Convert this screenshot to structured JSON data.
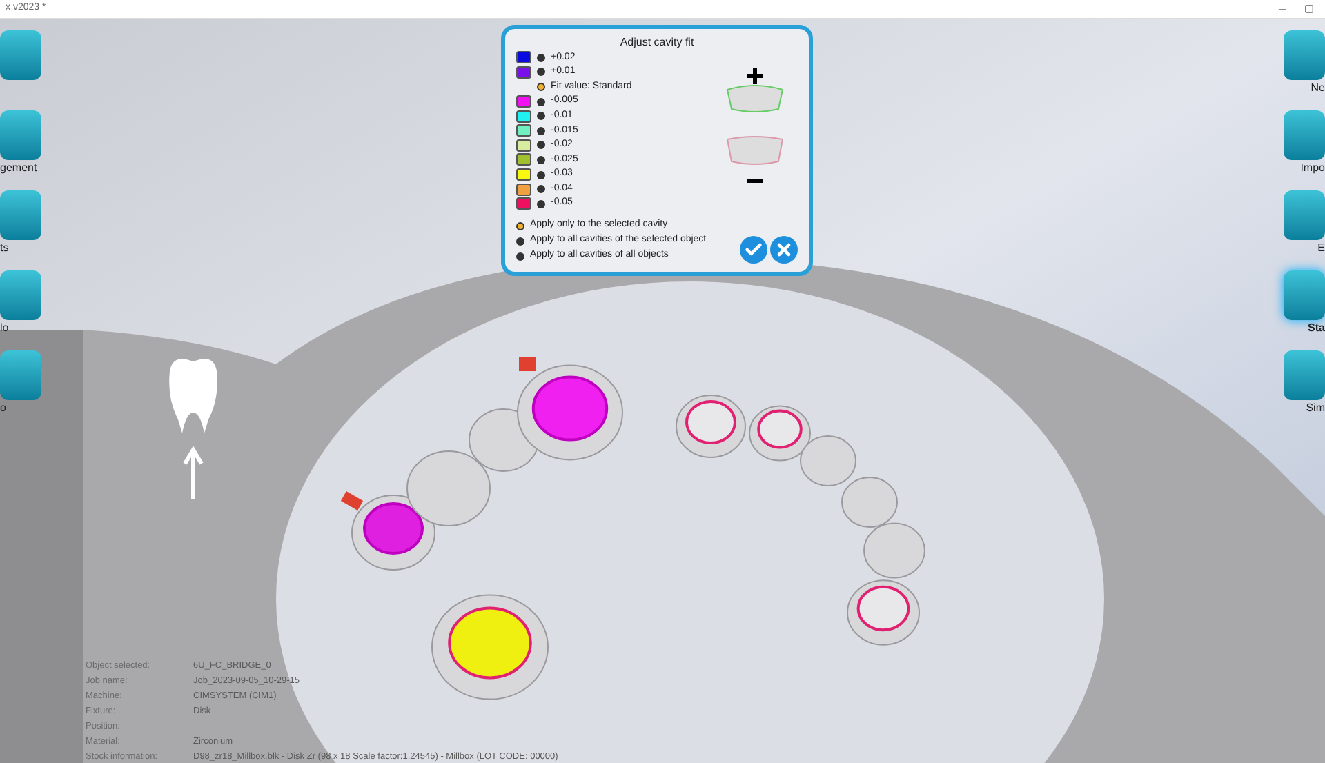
{
  "window": {
    "title": "x v2023 *"
  },
  "left_toolbar": [
    {
      "label": "gement"
    },
    {
      "label": "ts"
    },
    {
      "label": "lo"
    },
    {
      "label": "o"
    }
  ],
  "right_toolbar": [
    {
      "label": "Ne",
      "selected": false
    },
    {
      "label": "Impo",
      "selected": false
    },
    {
      "label": "E",
      "selected": false
    },
    {
      "label": "Sta",
      "selected": true
    },
    {
      "label": "Sim",
      "selected": false
    }
  ],
  "panel": {
    "title": "Adjust cavity fit",
    "fit_values": [
      {
        "kind": "swatch",
        "label": "+0.02",
        "color": "#0a0ae0",
        "selected": false
      },
      {
        "kind": "swatch",
        "label": "+0.01",
        "color": "#7a10e8",
        "selected": false
      },
      {
        "kind": "plain",
        "label": "Fit value: Standard",
        "selected": true
      },
      {
        "kind": "swatch",
        "label": "-0.005",
        "color": "#f010f0",
        "selected": false
      },
      {
        "kind": "swatch",
        "label": "-0.01",
        "color": "#20f0f0",
        "selected": false
      },
      {
        "kind": "swatch",
        "label": "-0.015",
        "color": "#70f0c0",
        "selected": false
      },
      {
        "kind": "swatch",
        "label": "-0.02",
        "color": "#d8eca0",
        "selected": false
      },
      {
        "kind": "swatch",
        "label": "-0.025",
        "color": "#a0c030",
        "selected": false
      },
      {
        "kind": "swatch",
        "label": "-0.03",
        "color": "#f8f810",
        "selected": false
      },
      {
        "kind": "swatch",
        "label": "-0.04",
        "color": "#f0a040",
        "selected": false
      },
      {
        "kind": "swatch",
        "label": "-0.05",
        "color": "#f01060",
        "selected": false
      }
    ],
    "apply_options": [
      {
        "label": "Apply only to the selected cavity",
        "selected": true
      },
      {
        "label": "Apply to all cavities of the selected object",
        "selected": false
      },
      {
        "label": "Apply to all cavities of all objects",
        "selected": false
      }
    ]
  },
  "info": [
    {
      "label": "Object selected:",
      "value": "6U_FC_BRIDGE_0"
    },
    {
      "label": "Job name:",
      "value": "Job_2023-09-05_10-29-15"
    },
    {
      "label": "Machine:",
      "value": "CIMSYSTEM (CIM1)"
    },
    {
      "label": "Fixture:",
      "value": "Disk"
    },
    {
      "label": "Position:",
      "value": "-"
    },
    {
      "label": "Material:",
      "value": "Zirconium"
    },
    {
      "label": "Stock information:",
      "value": "D98_zr18_Millbox.blk - Disk Zr (98 x 18 Scale factor:1.24545) - Millbox (LOT CODE: 00000)"
    }
  ]
}
